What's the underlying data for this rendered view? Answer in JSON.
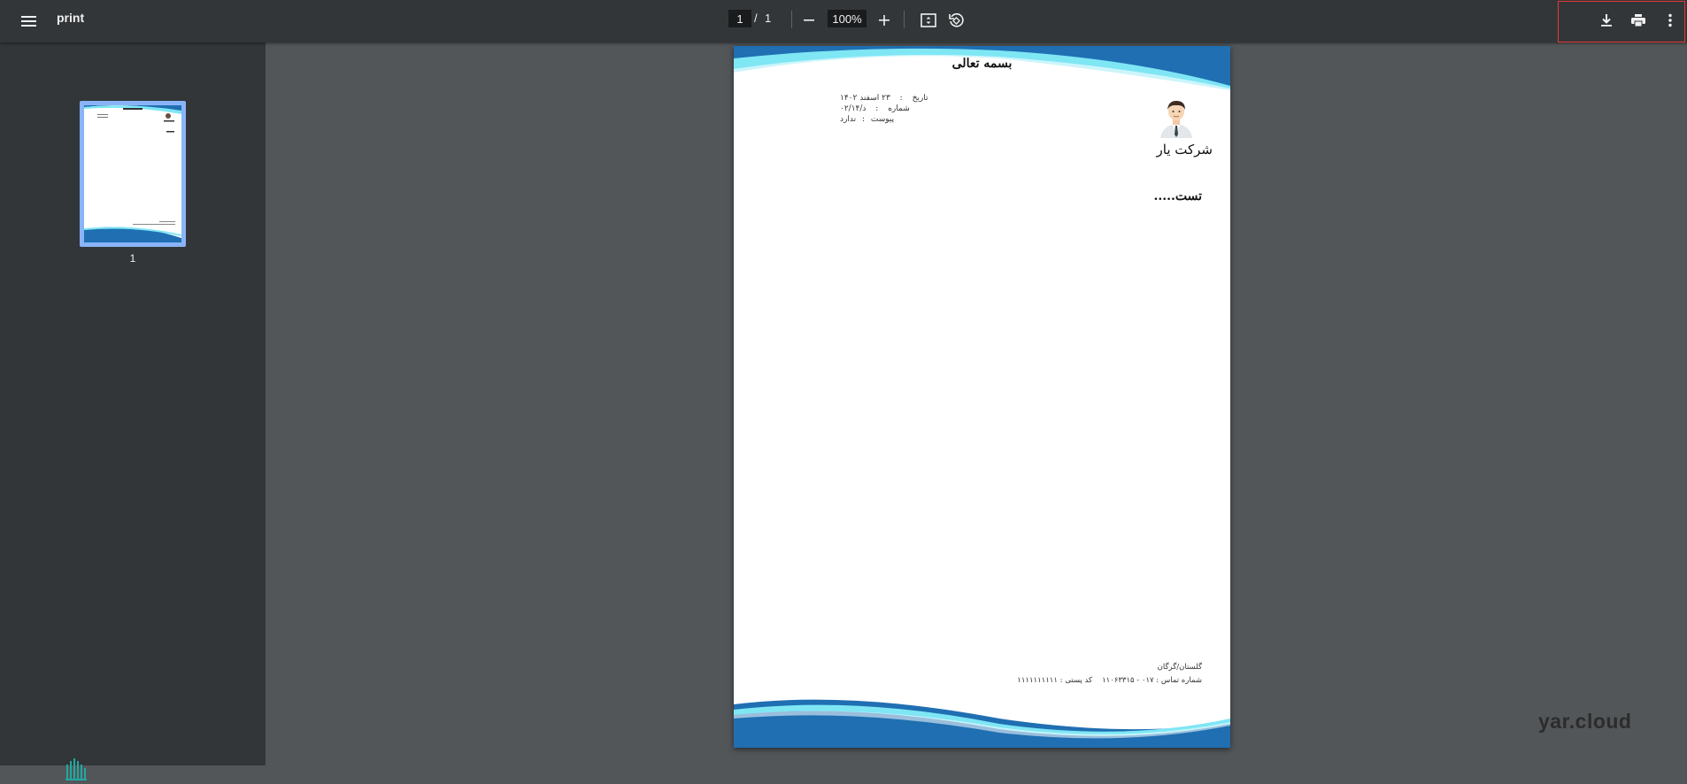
{
  "toolbar": {
    "title": "print",
    "current_page": "1",
    "page_separator": "/",
    "total_pages": "1",
    "zoom": "100%"
  },
  "sidebar": {
    "thumbnails": [
      {
        "label": "1"
      }
    ]
  },
  "document": {
    "heading": "بسمه تعالی",
    "meta": [
      {
        "label": "تاریخ",
        "sep": ":",
        "value": "۲۳ اسفند ۱۴۰۲"
      },
      {
        "label": "شماره",
        "sep": ":",
        "value": "د/۰۲/۱۴"
      },
      {
        "label": "پیوست",
        "sep": ":",
        "value": "ندارد"
      }
    ],
    "company_name": "شرکت یار",
    "body": "تست.....",
    "footer": {
      "address": "گلستان/گرگان",
      "phone": "شماره تماس : ۰۱۷ - ۱۱۰۶۳۳۱۵",
      "postal": "کد پستی : ۱۱۱۱۱۱۱۱۱۱"
    }
  },
  "watermark": "yar.cloud",
  "colors": {
    "toolbar": "#323639",
    "viewer_bg": "#525659",
    "wave_dark": "#1f6fb2",
    "wave_light": "#7fe6f4",
    "highlight": "#e53935"
  }
}
